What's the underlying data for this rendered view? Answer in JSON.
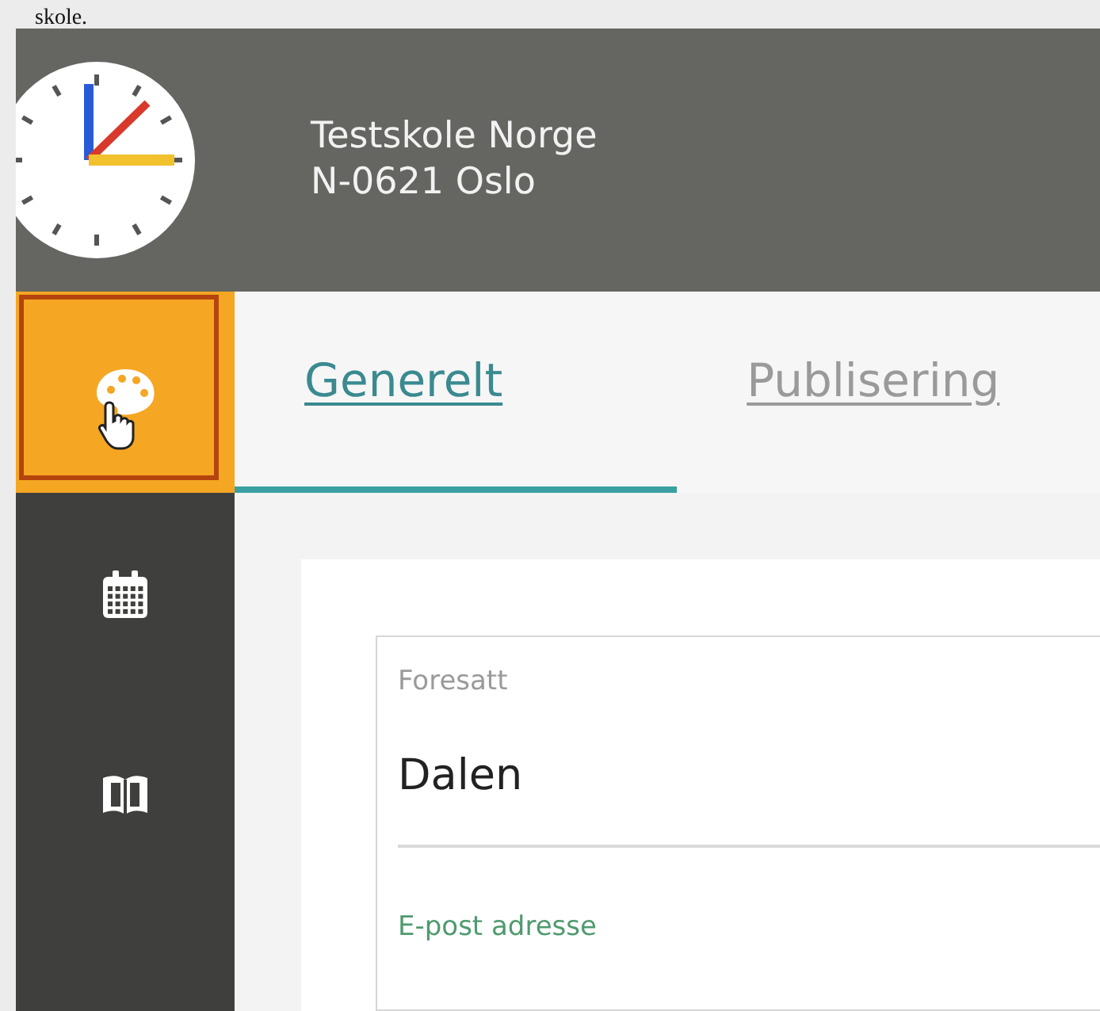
{
  "caption": "skole.",
  "header": {
    "school_name": "Testskole Norge",
    "school_address": "N-0621 Oslo"
  },
  "sidebar": {
    "items": [
      {
        "selected": true
      },
      {
        "selected": false
      },
      {
        "selected": false
      }
    ]
  },
  "tabs": [
    {
      "label": "Generelt",
      "selected": true
    },
    {
      "label": "Publisering",
      "selected": false
    }
  ],
  "form": {
    "fields": [
      {
        "label": "Foresatt",
        "value": "Dalen"
      },
      {
        "label": "E-post adresse"
      }
    ]
  }
}
